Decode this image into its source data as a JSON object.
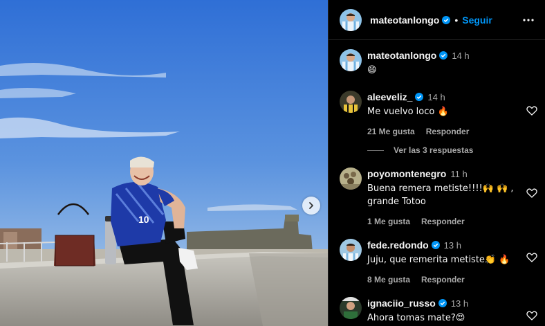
{
  "post": {
    "author": "mateotanlongo",
    "follow_label": "Seguir",
    "dot": "•",
    "caption": {
      "user": "mateotanlongo",
      "time": "14 h",
      "text": "😄"
    }
  },
  "comments": [
    {
      "user": "aleeveliz_",
      "time": "14 h",
      "text": "Me vuelvo loco 🔥",
      "likes": "21 Me gusta",
      "reply": "Responder",
      "verified": true
    },
    {
      "user": "poyomontenegro",
      "time": "11 h",
      "text": "Buena remera metiste!!!!🙌 🙌 , grande Totoo",
      "likes": "1 Me gusta",
      "reply": "Responder",
      "verified": false
    },
    {
      "user": "fede.redondo",
      "time": "13 h",
      "text": "Juju, que remerita metiste👏 🔥",
      "likes": "8 Me gusta",
      "reply": "Responder",
      "verified": true
    },
    {
      "user": "ignaciio_russo",
      "time": "13 h",
      "text": "Ahora tomas mate?😍",
      "verified": true
    }
  ],
  "view_replies": "Ver las 3 respuestas",
  "colors": {
    "verified": "#0095f6",
    "follow": "#0095f6",
    "muted": "#a8a8a8"
  },
  "icons": {
    "more": "more-options-icon",
    "heart": "heart-icon",
    "next": "chevron-right-icon",
    "verified": "verified-badge-icon"
  }
}
